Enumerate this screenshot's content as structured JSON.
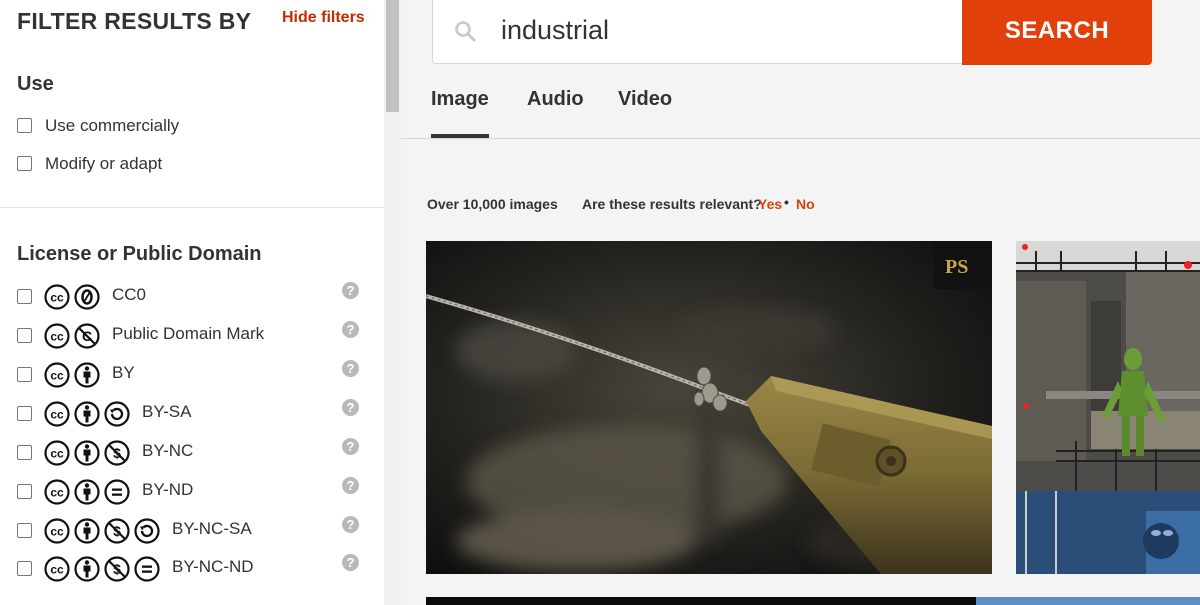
{
  "sidebar": {
    "title": "FILTER RESULTS BY",
    "hide_filters": "Hide filters",
    "use": {
      "heading": "Use",
      "options": [
        {
          "label": "Use commercially"
        },
        {
          "label": "Modify or adapt"
        }
      ]
    },
    "license": {
      "heading": "License or Public Domain",
      "options": [
        {
          "label": "CC0",
          "icons": [
            "cc-icon",
            "zero-icon"
          ]
        },
        {
          "label": "Public Domain Mark",
          "icons": [
            "cc-icon",
            "public-domain-icon"
          ]
        },
        {
          "label": "BY",
          "icons": [
            "cc-icon",
            "by-icon"
          ]
        },
        {
          "label": "BY-SA",
          "icons": [
            "cc-icon",
            "by-icon",
            "sa-icon"
          ]
        },
        {
          "label": "BY-NC",
          "icons": [
            "cc-icon",
            "by-icon",
            "nc-icon"
          ]
        },
        {
          "label": "BY-ND",
          "icons": [
            "cc-icon",
            "by-icon",
            "nd-icon"
          ]
        },
        {
          "label": "BY-NC-SA",
          "icons": [
            "cc-icon",
            "by-icon",
            "nc-icon",
            "sa-icon"
          ]
        },
        {
          "label": "BY-NC-ND",
          "icons": [
            "cc-icon",
            "by-icon",
            "nc-icon",
            "nd-icon"
          ]
        }
      ],
      "help_glyph": "?"
    }
  },
  "search": {
    "value": "industrial",
    "button_label": "SEARCH"
  },
  "tabs": [
    {
      "label": "Image",
      "active": true
    },
    {
      "label": "Audio",
      "active": false
    },
    {
      "label": "Video",
      "active": false
    }
  ],
  "results": {
    "count_text": "Over 10,000 images",
    "relevant_question": "Are these results relevant?",
    "yes": "Yes",
    "separator": "•",
    "no": "No",
    "watermark": "PS"
  },
  "colors": {
    "accent": "#e2400b",
    "link": "#c52b00",
    "text": "#333333",
    "main_bg": "#f4f4f4"
  }
}
